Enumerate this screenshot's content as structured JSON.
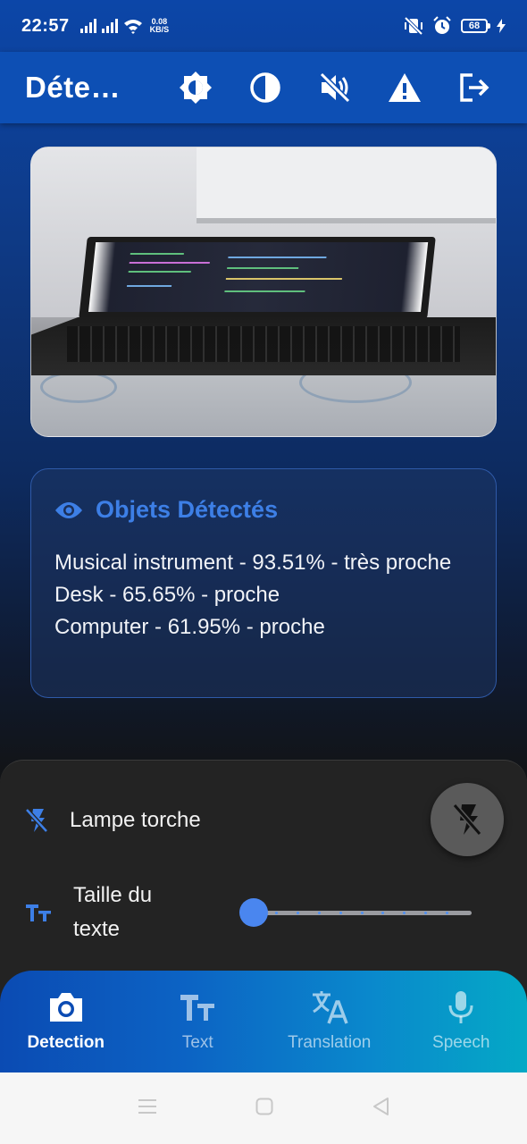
{
  "status_bar": {
    "time": "22:57",
    "net_speed_value": "0.08",
    "net_speed_unit": "KB/S",
    "battery": "68"
  },
  "app_bar": {
    "title": "Déte…",
    "icons": [
      "brightness-icon",
      "contrast-icon",
      "sound-off-icon",
      "warning-icon",
      "logout-icon"
    ]
  },
  "detected": {
    "title": "Objets Détectés",
    "items": [
      "Musical instrument - 93.51% - très proche",
      "Desk - 65.65% - proche",
      "Computer - 61.95% - proche"
    ]
  },
  "settings": {
    "torch_label": "Lampe torche",
    "text_size_label": "Taille du texte",
    "text_size_fraction": 0
  },
  "nav": {
    "items": [
      {
        "label": "Detection",
        "active": true
      },
      {
        "label": "Text",
        "active": false
      },
      {
        "label": "Translation",
        "active": false
      },
      {
        "label": "Speech",
        "active": false
      }
    ]
  },
  "colors": {
    "app_bar": "#0d4fb4",
    "accent": "#3d7fe6",
    "sheet": "#232323"
  }
}
